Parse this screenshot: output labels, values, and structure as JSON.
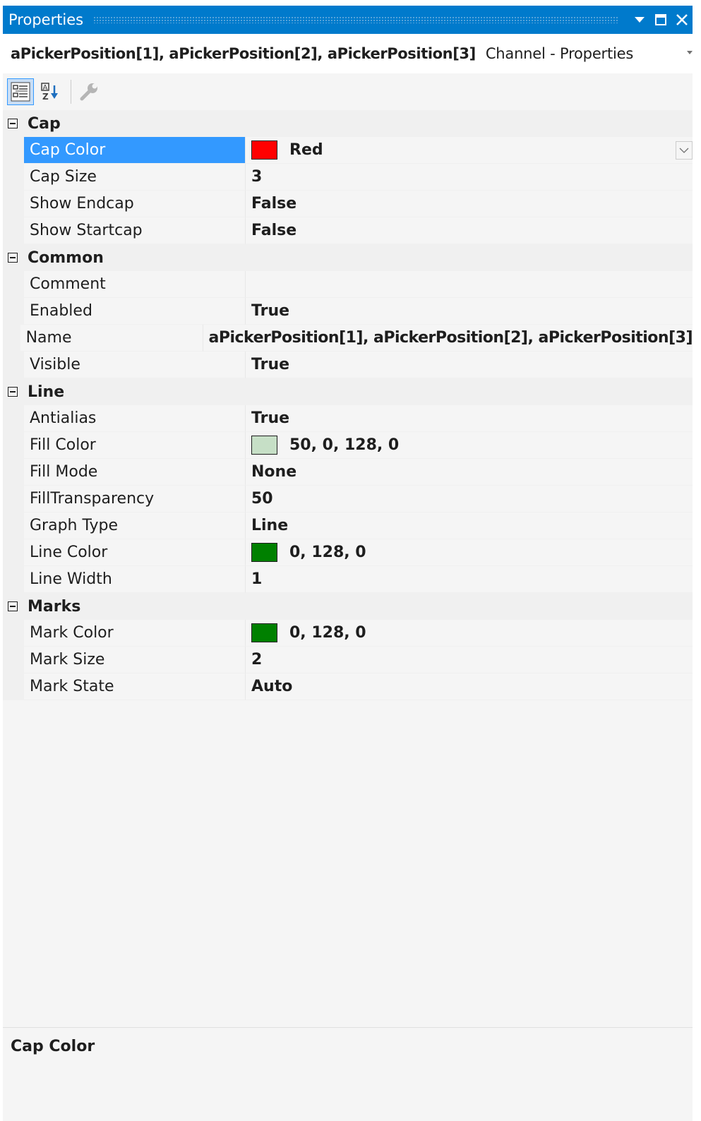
{
  "window": {
    "title": "Properties",
    "controls": [
      "dropdown",
      "maximize",
      "close"
    ]
  },
  "object_selector": {
    "name": "aPickerPosition[1], aPickerPosition[2], aPickerPosition[3]",
    "type": "Channel - Properties"
  },
  "toolbar": {
    "buttons": [
      "categorized-icon",
      "alphabetical-icon",
      "property-pages-icon"
    ],
    "active": "categorized-icon"
  },
  "categories": [
    {
      "name": "Cap",
      "properties": [
        {
          "name": "Cap Color",
          "value": "Red",
          "swatch": "#ff0000",
          "selected": true
        },
        {
          "name": "Cap Size",
          "value": "3"
        },
        {
          "name": "Show Endcap",
          "value": "False"
        },
        {
          "name": "Show Startcap",
          "value": "False"
        }
      ]
    },
    {
      "name": "Common",
      "properties": [
        {
          "name": "Comment",
          "value": ""
        },
        {
          "name": "Enabled",
          "value": "True"
        },
        {
          "name": "Name",
          "value": "aPickerPosition[1], aPickerPosition[2], aPickerPosition[3]"
        },
        {
          "name": "Visible",
          "value": "True"
        }
      ]
    },
    {
      "name": "Line",
      "properties": [
        {
          "name": "Antialias",
          "value": "True"
        },
        {
          "name": "Fill Color",
          "value": "50, 0, 128, 0",
          "swatch": "#c6dfc6"
        },
        {
          "name": "Fill Mode",
          "value": "None"
        },
        {
          "name": "FillTransparency",
          "value": "50"
        },
        {
          "name": "Graph Type",
          "value": "Line"
        },
        {
          "name": "Line Color",
          "value": "0, 128, 0",
          "swatch": "#008000"
        },
        {
          "name": "Line Width",
          "value": "1"
        }
      ]
    },
    {
      "name": "Marks",
      "properties": [
        {
          "name": "Mark Color",
          "value": "0, 128, 0",
          "swatch": "#008000"
        },
        {
          "name": "Mark Size",
          "value": "2"
        },
        {
          "name": "Mark State",
          "value": "Auto"
        }
      ]
    }
  ],
  "description": {
    "title": "Cap Color"
  },
  "colors": {
    "accent": "#007acc",
    "selection": "#3399ff"
  }
}
